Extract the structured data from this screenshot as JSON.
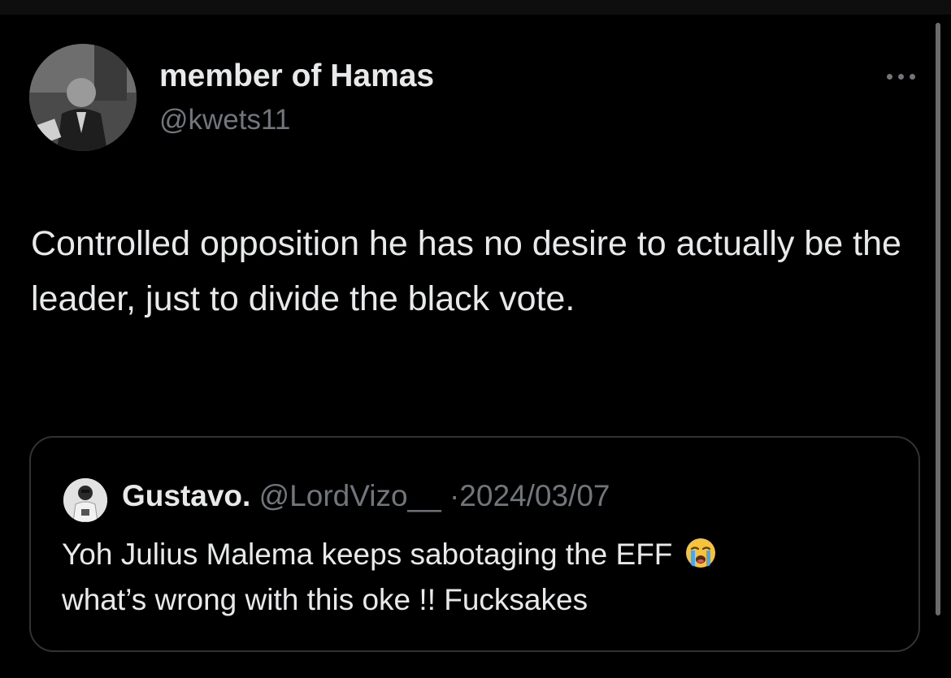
{
  "tweet": {
    "display_name": "member of Hamas",
    "handle": "@kwets11",
    "text": "Controlled opposition he has no desire to actually be the leader, just to divide the black vote.",
    "avatar_icon": "profile-photo-avatar",
    "more_icon": "more-options-icon"
  },
  "quote": {
    "display_name": "Gustavo.",
    "handle": "@LordVizo__",
    "separator": "·",
    "date": "2024/03/07",
    "text_line1": "Yoh Julius Malema keeps sabotaging the EFF",
    "text_line2": "what’s wrong with this oke !! Fucksakes",
    "emoji": "loudly-crying-face-emoji",
    "avatar_icon": "profile-photo-avatar"
  },
  "colors": {
    "background": "#000000",
    "primary_text": "#e7e9ea",
    "secondary_text": "#71767b",
    "border": "#2f3336"
  }
}
